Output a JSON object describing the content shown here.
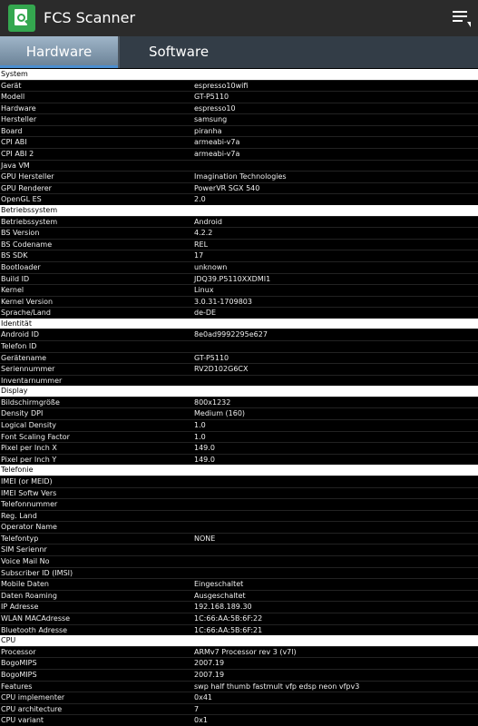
{
  "app": {
    "title": "FCS Scanner"
  },
  "tabs": [
    {
      "label": "Hardware"
    },
    {
      "label": "Software"
    }
  ],
  "sections": [
    {
      "title": "System",
      "rows": [
        {
          "k": "Gerät",
          "v": "espresso10wifi"
        },
        {
          "k": "Modell",
          "v": "GT-P5110"
        },
        {
          "k": "Hardware",
          "v": "espresso10"
        },
        {
          "k": "Hersteller",
          "v": "samsung"
        },
        {
          "k": "Board",
          "v": "piranha"
        },
        {
          "k": "CPI ABI",
          "v": "armeabi-v7a"
        },
        {
          "k": "CPI ABI 2",
          "v": "armeabi-v7a"
        },
        {
          "k": "Java VM",
          "v": ""
        },
        {
          "k": "GPU Hersteller",
          "v": "Imagination Technologies"
        },
        {
          "k": "GPU Renderer",
          "v": "PowerVR SGX 540"
        },
        {
          "k": "OpenGL ES",
          "v": "2.0"
        }
      ]
    },
    {
      "title": "Betriebssystem",
      "rows": [
        {
          "k": "Betriebssystem",
          "v": "Android"
        },
        {
          "k": "BS Version",
          "v": "4.2.2"
        },
        {
          "k": "BS Codename",
          "v": "REL"
        },
        {
          "k": "BS SDK",
          "v": "17"
        },
        {
          "k": "Bootloader",
          "v": "unknown"
        },
        {
          "k": "Build ID",
          "v": "JDQ39.P5110XXDMI1"
        },
        {
          "k": "Kernel",
          "v": "Linux"
        },
        {
          "k": "Kernel Version",
          "v": "3.0.31-1709803"
        },
        {
          "k": "Sprache/Land",
          "v": "de-DE"
        }
      ]
    },
    {
      "title": "Identität",
      "rows": [
        {
          "k": "Android ID",
          "v": "8e0ad9992295e627"
        },
        {
          "k": "Telefon ID",
          "v": ""
        },
        {
          "k": "Gerätename",
          "v": "GT-P5110"
        },
        {
          "k": "Seriennummer",
          "v": "RV2D102G6CX"
        },
        {
          "k": "Inventarnummer",
          "v": ""
        }
      ]
    },
    {
      "title": "Display",
      "rows": [
        {
          "k": "Bildschirmgröße",
          "v": "800x1232"
        },
        {
          "k": "Density DPI",
          "v": "Medium (160)"
        },
        {
          "k": "Logical Density",
          "v": "1.0"
        },
        {
          "k": "Font Scaling Factor",
          "v": "1.0"
        },
        {
          "k": "Pixel per Inch X",
          "v": "149.0"
        },
        {
          "k": "Pixel per Inch Y",
          "v": "149.0"
        }
      ]
    },
    {
      "title": "Telefonie",
      "rows": [
        {
          "k": "IMEI (or MEID)",
          "v": ""
        },
        {
          "k": "IMEI Softw Vers",
          "v": ""
        },
        {
          "k": "Telefonnummer",
          "v": ""
        },
        {
          "k": "Reg. Land",
          "v": ""
        },
        {
          "k": "Operator Name",
          "v": ""
        },
        {
          "k": "Telefontyp",
          "v": "NONE"
        },
        {
          "k": "SIM Seriennr",
          "v": ""
        },
        {
          "k": "Voice Mail No",
          "v": ""
        },
        {
          "k": "Subscriber ID (IMSI)",
          "v": ""
        },
        {
          "k": "Mobile Daten",
          "v": "Eingeschaltet"
        },
        {
          "k": "Daten Roaming",
          "v": "Ausgeschaltet"
        },
        {
          "k": "IP Adresse",
          "v": "192.168.189.30"
        },
        {
          "k": "WLAN MACAdresse",
          "v": "1C:66:AA:5B:6F:22"
        },
        {
          "k": "Bluetooth Adresse",
          "v": "1C:66:AA:5B:6F:21"
        }
      ]
    },
    {
      "title": "CPU",
      "rows": [
        {
          "k": "Processor",
          "v": "ARMv7 Processor rev 3 (v7l)"
        },
        {
          "k": "BogoMIPS",
          "v": "2007.19"
        },
        {
          "k": "BogoMIPS",
          "v": "2007.19"
        },
        {
          "k": "Features",
          "v": "swp half thumb fastmult vfp edsp neon vfpv3"
        },
        {
          "k": "CPU implementer",
          "v": "0x41"
        },
        {
          "k": "CPU architecture",
          "v": "7"
        },
        {
          "k": "CPU variant",
          "v": "0x1"
        }
      ]
    }
  ]
}
